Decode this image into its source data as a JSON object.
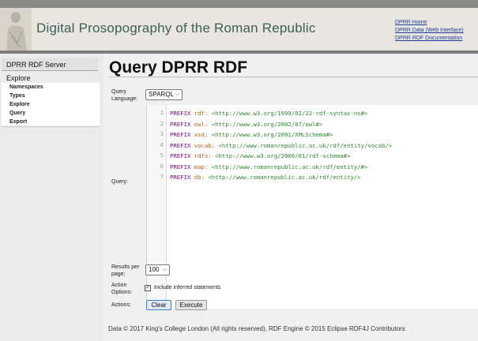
{
  "header": {
    "site_title": "Digital Prosopography of the Roman Republic",
    "links": [
      "DPRR Home",
      "DPRR Data (Web Interface)",
      "DPRR RDF Documentation"
    ]
  },
  "sidebar": {
    "title": "DPRR RDF Server",
    "section": "Explore",
    "items": [
      "Namespaces",
      "Types",
      "Explore",
      "Query",
      "Export"
    ]
  },
  "main": {
    "page_title": "Query DPRR RDF",
    "query_language_label": "Query Language:",
    "query_language_value": "SPARQL",
    "query_label": "Query:",
    "query_lines": [
      {
        "num": "1",
        "kw": "PREFIX",
        "prefix": "rdf:",
        "uri": "<http://www.w3.org/1999/02/22-rdf-syntax-ns#>"
      },
      {
        "num": "2",
        "kw": "PREFIX",
        "prefix": "owl:",
        "uri": "<http://www.w3.org/2002/07/owl#>"
      },
      {
        "num": "3",
        "kw": "PREFIX",
        "prefix": "xsd:",
        "uri": "<http://www.w3.org/2001/XMLSchema#>"
      },
      {
        "num": "4",
        "kw": "PREFIX",
        "prefix": "vocab:",
        "uri": "<http://www.romanrepublic.ac.uk/rdf/entity/vocab/>"
      },
      {
        "num": "5",
        "kw": "PREFIX",
        "prefix": "rdfs:",
        "uri": "<http://www.w3.org/2000/01/rdf-schema#>"
      },
      {
        "num": "6",
        "kw": "PREFIX",
        "prefix": "map:",
        "uri": "<http://www.romanrepublic.ac.uk/rdf/entity/#>"
      },
      {
        "num": "7",
        "kw": "PREFIX",
        "prefix": "db:",
        "uri": "<http://www.romanrepublic.ac.uk/rdf/entity/>"
      }
    ],
    "results_per_page_label": "Results per page:",
    "results_per_page_value": "100",
    "action_options_label": "Action Options:",
    "include_inferred_label": "Include inferred statements",
    "include_inferred_checked": true,
    "actions_label": "Actions:",
    "clear_label": "Clear",
    "execute_label": "Execute"
  },
  "footer": {
    "text": "Data © 2017 King's College London (All rights reserved), RDF Engine © 2015 Eclipse RDF4J Contributors"
  },
  "colors": {
    "title_color": "#3c5f5b",
    "link_color": "#1a3d9a",
    "keyword": "#7a0f82",
    "prefix": "#c06010",
    "uri": "#2d8a2d"
  }
}
